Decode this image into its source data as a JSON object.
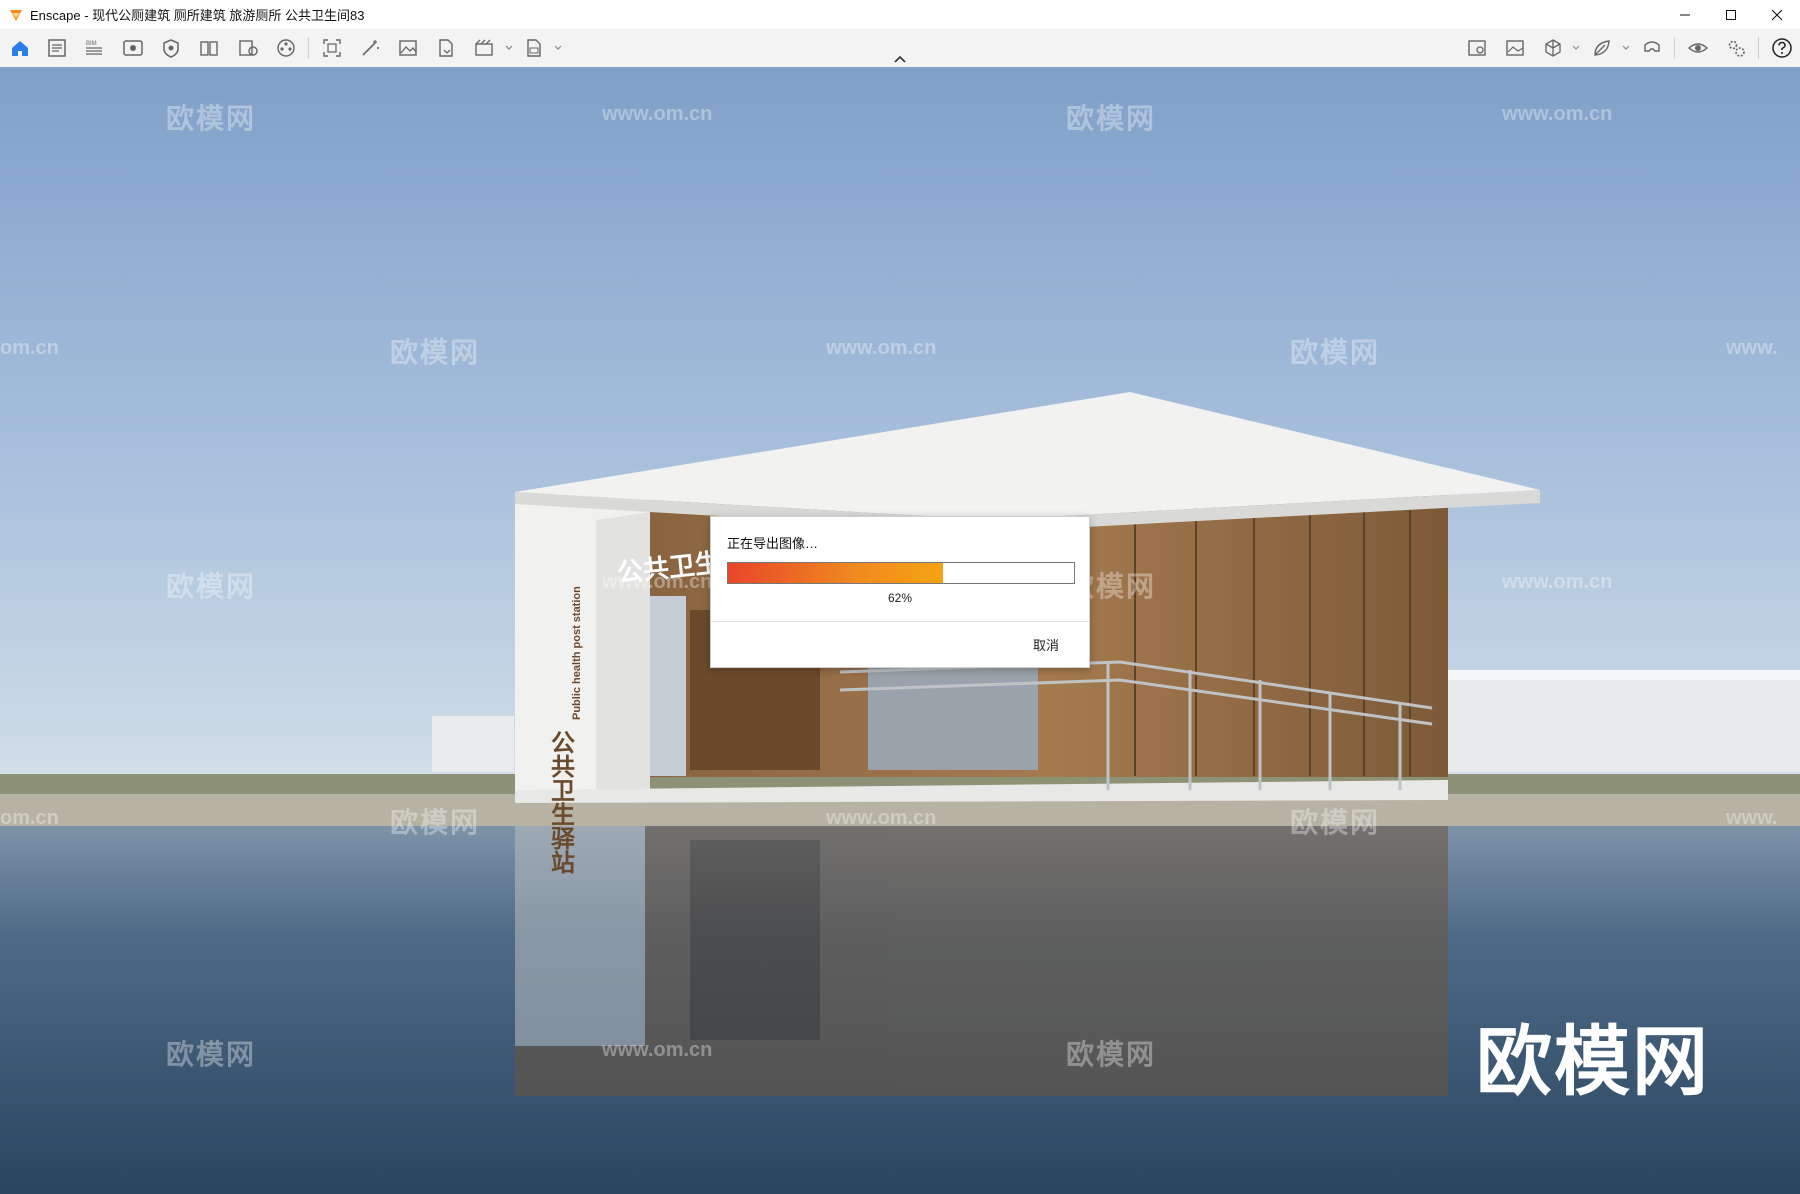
{
  "window": {
    "title": "Enscape - 现代公厕建筑 厕所建筑 旅游厕所 公共卫生间83"
  },
  "toolbar": {
    "left_icons": [
      "home-icon",
      "document-list-icon",
      "bim-icon",
      "view-icon",
      "safe-frame-icon",
      "views-list-icon",
      "asset-library-icon",
      "video-editor-icon",
      "screenshot-icon",
      "atmosphere-icon",
      "render-image-icon",
      "export-icon",
      "batch-render-icon",
      "exe-export-icon"
    ],
    "right_icons": [
      "map-icon",
      "image-editor-icon",
      "cube-icon",
      "leaf-icon",
      "vr-headset-icon",
      "visual-settings-icon",
      "settings-gear-icon",
      "help-icon"
    ],
    "bim_label": "BIM"
  },
  "dialog": {
    "title": "正在导出图像…",
    "progress": 0.62,
    "progress_label": "62%",
    "cancel_label": "取消"
  },
  "scene": {
    "sign_cn_vertical": "公共卫生驿站",
    "sign_en_vertical": "Public health post station",
    "sign_facade": "公共卫生驿",
    "watermark_brand": "欧模网",
    "watermark_url": "www.om.cn",
    "watermark_url_partial": "om.cn",
    "watermark_url_edge": "www.",
    "brand_logo": "欧模网"
  },
  "colors": {
    "accent": "#f08a1f",
    "toolbar_bg": "#f3f3f3",
    "home_blue": "#2b7de9"
  }
}
